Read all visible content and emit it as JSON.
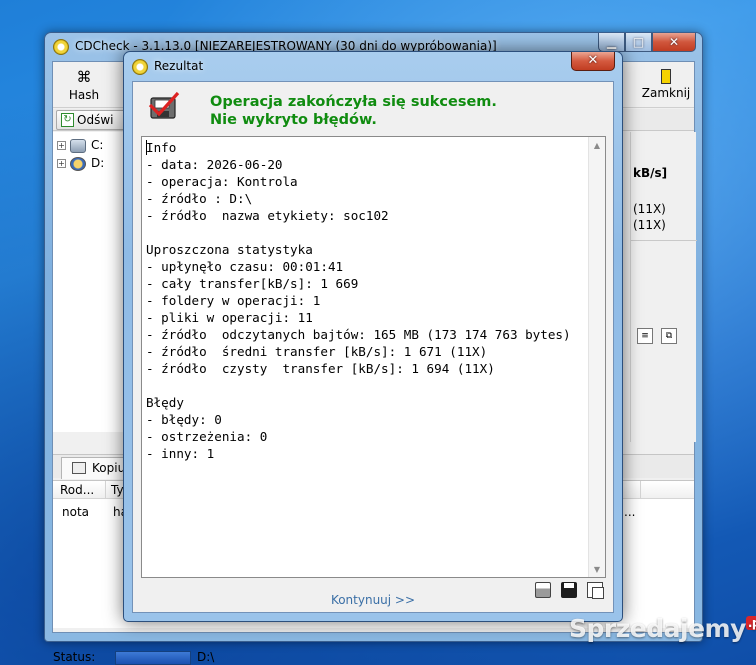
{
  "main_window": {
    "title": "CDCheck - 3.1.13.0 [NIEZAREJESTROWANY (30 dni do wypróbowania)]",
    "caption_buttons": {
      "minimize": "▁",
      "maximize": "□",
      "close": "✕"
    },
    "toolbar": {
      "hash_label": "Hash",
      "close_label": "Zamknij"
    },
    "refresh_label": "Odświ",
    "tree": [
      {
        "label": "C:"
      },
      {
        "label": "D:"
      }
    ],
    "right_panel": {
      "header": "kB/s]",
      "rows": [
        "(11X)",
        "(11X)"
      ]
    },
    "bottom_tab_label": "Kopiu",
    "grid": {
      "headers": [
        "Rod...",
        "Ty"
      ],
      "row": [
        "nota",
        "ha",
        "..."
      ]
    },
    "status": {
      "label": "Status:",
      "path": "D:\\"
    }
  },
  "dialog": {
    "title": "Rezultat",
    "close": "✕",
    "success_line1": "Operacja zakończyła się sukcesem.",
    "success_line2": "Nie wykryto błędów.",
    "report": "Info\n- data: 2026-06-20\n- operacja: Kontrola\n- źródło : D:\\\n- źródło  nazwa etykiety: soc102\n\nUproszczona statystyka\n- upłynęło czasu: 00:01:41\n- cały transfer[kB/s]: 1 669\n- foldery w operacji: 1\n- pliki w operacji: 11\n- źródło  odczytanych bajtów: 165 MB (173 174 763 bytes)\n- źródło  średni transfer [kB/s]: 1 671 (11X)\n- źródło  czysty  transfer [kB/s]: 1 694 (11X)\n\nBłędy\n- błędy: 0\n- ostrzeżenia: 0\n- inny: 1",
    "continue_label": "Kontynuuj >>",
    "icons": [
      "printer-icon",
      "save-icon",
      "copy-icon"
    ]
  },
  "watermark": {
    "name": "Sprzedajemy",
    "tld": ".pl"
  },
  "colors": {
    "success_green": "#108c10",
    "continue_link": "#3a6fa6",
    "close_red": "#c13d22",
    "desktop_blue": "#1f7fd8"
  }
}
